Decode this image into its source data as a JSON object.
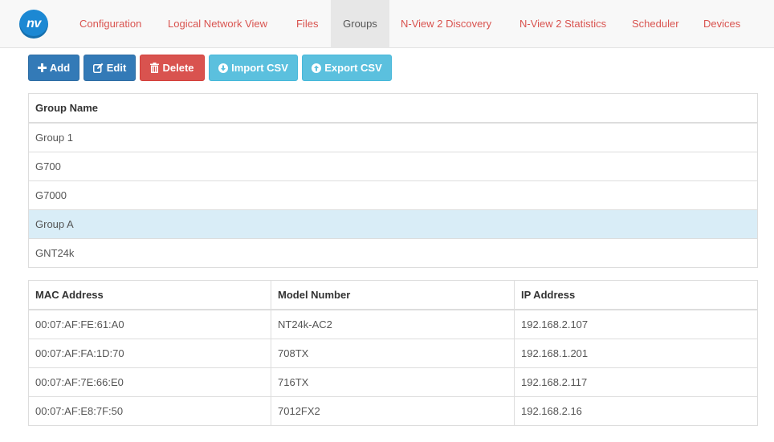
{
  "logo": {
    "text": "nv"
  },
  "nav": {
    "items": [
      {
        "label": "Configuration"
      },
      {
        "label": "Logical Network View"
      },
      {
        "label": "Files"
      },
      {
        "label": "Groups",
        "active": true
      },
      {
        "label": "N-View 2 Discovery"
      },
      {
        "label": "N-View 2 Statistics"
      },
      {
        "label": "Scheduler"
      },
      {
        "label": "Devices"
      }
    ]
  },
  "toolbar": {
    "add_label": "Add",
    "edit_label": "Edit",
    "delete_label": "Delete",
    "import_label": "Import CSV",
    "export_label": "Export CSV"
  },
  "groups_table": {
    "header": "Group Name",
    "rows": [
      "Group 1",
      "G700",
      "G7000",
      "Group A",
      "GNT24k"
    ],
    "selected_row": "Group A"
  },
  "devices_table": {
    "headers": [
      "MAC Address",
      "Model Number",
      "IP Address"
    ],
    "rows": [
      [
        "00:07:AF:FE:61:A0",
        "NT24k-AC2",
        "192.168.2.107"
      ],
      [
        "00:07:AF:FA:1D:70",
        "708TX",
        "192.168.1.201"
      ],
      [
        "00:07:AF:7E:66:E0",
        "716TX",
        "192.168.2.117"
      ],
      [
        "00:07:AF:E8:7F:50",
        "7012FX2",
        "192.168.2.16"
      ]
    ]
  },
  "colors": {
    "nav_link": "#d9534f",
    "primary": "#337ab7",
    "danger": "#d9534f",
    "info": "#5bc0de",
    "selected_row": "#d9edf7",
    "logo": "#1c88d3"
  }
}
